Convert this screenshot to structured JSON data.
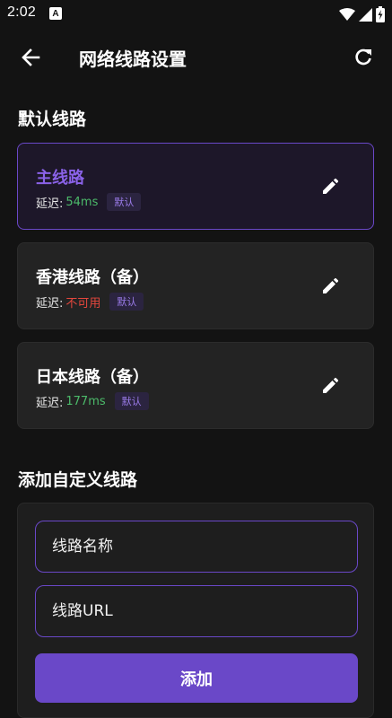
{
  "status_bar": {
    "time": "2:02",
    "notification_icon": "A",
    "icons": [
      "wifi-icon",
      "cell-signal-icon",
      "battery-icon"
    ]
  },
  "app_bar": {
    "title": "网络线路设置",
    "back_icon": "arrow-left-icon",
    "refresh_icon": "refresh-icon"
  },
  "default_routes": {
    "title": "默认线路",
    "latency_label": "延迟:",
    "items": [
      {
        "name": "主线路",
        "latency": "54ms",
        "status": "good",
        "badge": "默认",
        "selected": true
      },
      {
        "name": "香港线路（备）",
        "latency": "不可用",
        "status": "bad",
        "badge": "默认",
        "selected": false
      },
      {
        "name": "日本线路（备）",
        "latency": "177ms",
        "status": "good",
        "badge": "默认",
        "selected": false
      }
    ]
  },
  "custom_route": {
    "title": "添加自定义线路",
    "name_placeholder": "线路名称",
    "name_value": "",
    "url_placeholder": "线路URL",
    "url_value": "",
    "add_label": "添加"
  },
  "colors": {
    "background": "#131313",
    "accent": "#6a48c8",
    "accent_text": "#8a62e8",
    "latency_good": "#4cbb6a",
    "latency_bad": "#e5473d"
  }
}
